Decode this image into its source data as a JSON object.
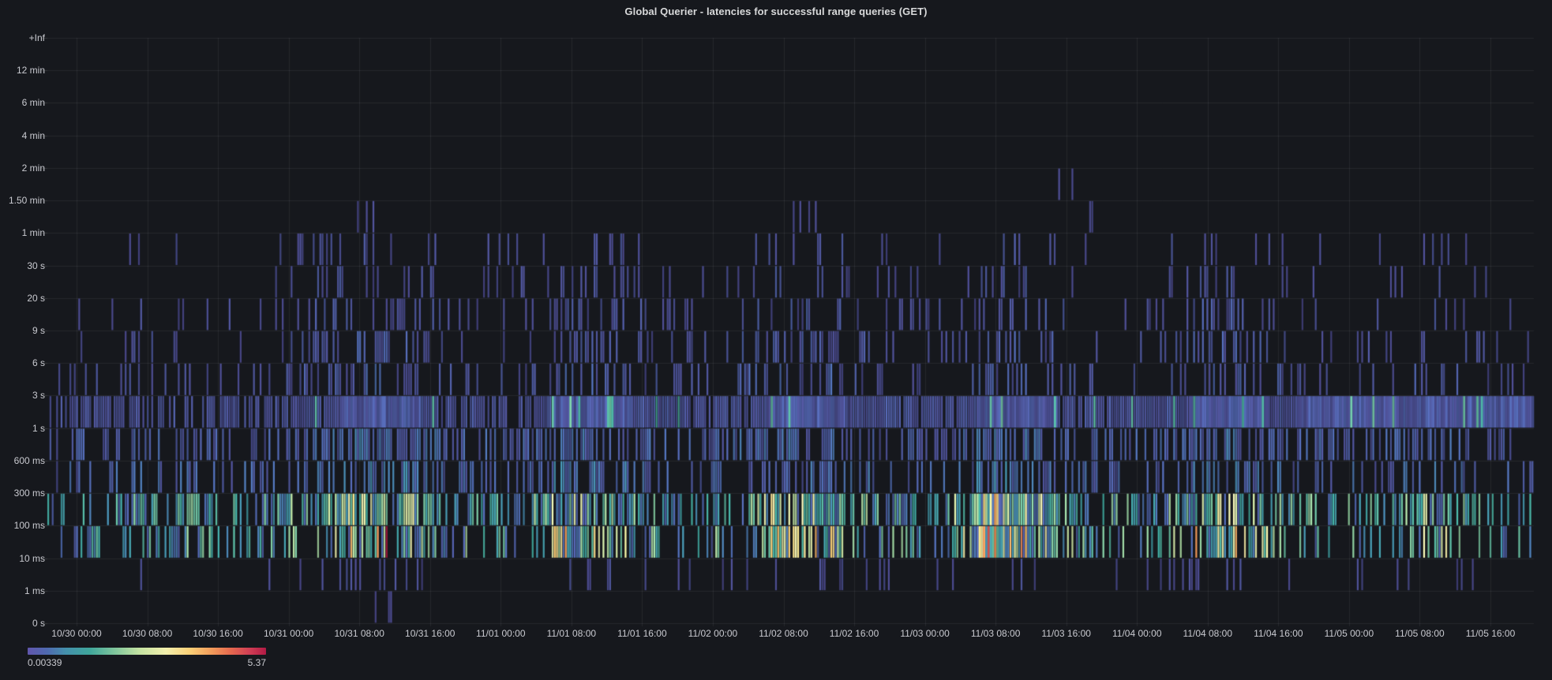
{
  "panel": {
    "title": "Global Querier - latencies for successful range queries (GET)"
  },
  "colors": {
    "background": "#16181d",
    "text": "#c9cad0",
    "grid": "rgba(255,255,255,0.07)",
    "axis_dash": "rgba(255,255,255,0.14)"
  },
  "chart_data": {
    "type": "heatmap",
    "title": "Global Querier - latencies for successful range queries (GET)",
    "grid": true,
    "legend_position": "bottom-left",
    "y_tick_labels": [
      "+Inf",
      "12 min",
      "6 min",
      "4 min",
      "2 min",
      "1.50 min",
      "1 min",
      "30 s",
      "20 s",
      "9 s",
      "6 s",
      "3 s",
      "1 s",
      "600 ms",
      "300 ms",
      "100 ms",
      "10 ms",
      "1 ms",
      "0 s"
    ],
    "x_tick_labels": [
      "10/30 00:00",
      "10/30 08:00",
      "10/30 16:00",
      "10/31 00:00",
      "10/31 08:00",
      "10/31 16:00",
      "11/01 00:00",
      "11/01 08:00",
      "11/01 16:00",
      "11/02 00:00",
      "11/02 08:00",
      "11/02 16:00",
      "11/03 00:00",
      "11/03 08:00",
      "11/03 16:00",
      "11/04 00:00",
      "11/04 08:00",
      "11/04 16:00",
      "11/05 00:00",
      "11/05 08:00",
      "11/05 16:00"
    ],
    "color_scale": {
      "min": 0.00339,
      "max": 5.37,
      "min_label": "0.00339",
      "max_label": "5.37",
      "gradient": [
        [
          0,
          "#6156ad"
        ],
        [
          0.08,
          "#4f69b0"
        ],
        [
          0.16,
          "#4490ac"
        ],
        [
          0.26,
          "#3fa69b"
        ],
        [
          0.36,
          "#7cc49c"
        ],
        [
          0.47,
          "#c5e3a2"
        ],
        [
          0.58,
          "#f2efad"
        ],
        [
          0.68,
          "#fbd077"
        ],
        [
          0.77,
          "#f29c5b"
        ],
        [
          0.85,
          "#e66a4e"
        ],
        [
          0.93,
          "#d13f55"
        ],
        [
          1,
          "#b11a45"
        ]
      ]
    },
    "profile_step_hours": 3,
    "time_steps": 56,
    "columns": 672,
    "rows": [
      {
        "bucket": "12 min – +Inf",
        "profile": "00000000000000000000000000000000000000000000000000000000",
        "fill": [
          0,
          0
        ],
        "t": [
          0,
          0
        ]
      },
      {
        "bucket": "6 min – 12 min",
        "profile": "00000000000000000000000000000000000000000000000000000000",
        "fill": [
          0,
          0
        ],
        "t": [
          0,
          0
        ]
      },
      {
        "bucket": "4 min – 6 min",
        "profile": "00000000000000000000000000000000000000000000000000000000",
        "fill": [
          0,
          0
        ],
        "t": [
          0,
          0
        ]
      },
      {
        "bucket": "2 min – 4 min",
        "profile": "00000000000000000000000000000000000000000000000000000000",
        "fill": [
          0,
          0
        ],
        "t": [
          0,
          0
        ]
      },
      {
        "bucket": "1.50 min – 2 min",
        "profile": "00000000000100000000000000000000000002100000000000000000",
        "fill": [
          0.1,
          0.35
        ],
        "t": [
          0.02,
          0.06
        ]
      },
      {
        "bucket": "1 min – 1.50 min",
        "profile": "00000000000110000000000000001000000000110000100000000000",
        "fill": [
          0.1,
          0.35
        ],
        "t": [
          0.02,
          0.07
        ]
      },
      {
        "bucket": "30 s – 1 min",
        "profile": "00011000122444211212332110233321010232110033322100122100",
        "fill": [
          0.06,
          0.5
        ],
        "t": [
          0.02,
          0.1
        ]
      },
      {
        "bucket": "20 s – 30 s",
        "profile": "00011100123554311223342111344431111343210134432101122110",
        "fill": [
          0.07,
          0.5
        ],
        "t": [
          0.02,
          0.1
        ]
      },
      {
        "bucket": "9 s – 20 s",
        "profile": "01122110234665321234443211455532112454311135543101233211",
        "fill": [
          0.08,
          0.55
        ],
        "t": [
          0.02,
          0.11
        ]
      },
      {
        "bucket": "6 s – 9 s",
        "profile": "01122211235775422235543222466542123554321245543211233221",
        "fill": [
          0.09,
          0.6
        ],
        "t": [
          0.02,
          0.11
        ]
      },
      {
        "bucket": "3 s – 6 s",
        "profile": "12233322245776432346654322566643224665422246654212344322",
        "fill": [
          0.09,
          0.6
        ],
        "t": [
          0.02,
          0.12
        ]
      },
      {
        "bucket": "1 s – 3 s",
        "profile": "44455555578999887789998877899988788999888889998999999999",
        "fill": [
          0.35,
          1.0
        ],
        "t": [
          0.03,
          0.07
        ]
      },
      {
        "bucket": "600 ms – 1 s",
        "profile": "33344433456887644457775444677754345776543457765433455433",
        "fill": [
          0.22,
          0.85
        ],
        "t": [
          0.03,
          0.16
        ]
      },
      {
        "bucket": "300 ms – 600 ms",
        "profile": "33333333345776543446664333566643334675433346654323344332",
        "fill": [
          0.16,
          0.7
        ],
        "t": [
          0.03,
          0.22
        ]
      },
      {
        "bucket": "100 ms – 300 ms",
        "profile": "33344433456887544458875444688754446987544458865434466433",
        "fill": [
          0.22,
          0.95
        ],
        "t": [
          0.06,
          0.72
        ]
      },
      {
        "bucket": "10 ms – 100 ms",
        "profile": "22233322345886433347764333577643336986433357764323355332",
        "fill": [
          0.13,
          0.92
        ],
        "t": [
          0.05,
          0.95
        ]
      },
      {
        "bucket": "1 ms – 10 ms",
        "profile": "01111110122443211123332111233321113543211124432101122110",
        "fill": [
          0.06,
          0.4
        ],
        "t": [
          0.02,
          0.07
        ]
      },
      {
        "bucket": "0 s – 1 ms",
        "profile": "00000000001010010000000000000000000010000000100000000000",
        "fill": [
          0.09,
          0.09
        ],
        "t": [
          0.02,
          0.05
        ]
      }
    ]
  }
}
